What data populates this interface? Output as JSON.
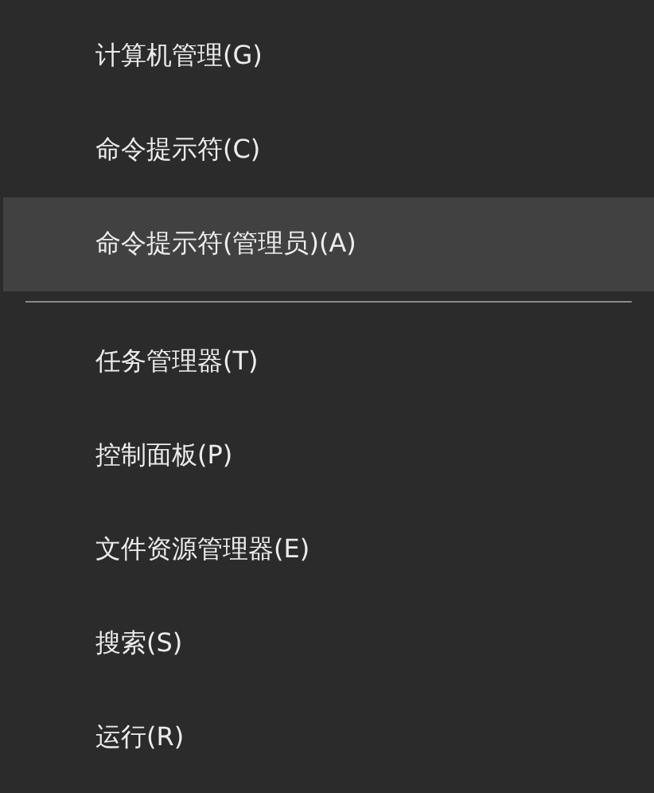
{
  "menu": {
    "items": [
      {
        "kind": "item",
        "label": "计算机管理(G)",
        "selected": false
      },
      {
        "kind": "item",
        "label": "命令提示符(C)",
        "selected": false
      },
      {
        "kind": "item",
        "label": "命令提示符(管理员)(A)",
        "selected": true
      },
      {
        "kind": "separator"
      },
      {
        "kind": "item",
        "label": "任务管理器(T)",
        "selected": false
      },
      {
        "kind": "item",
        "label": "控制面板(P)",
        "selected": false
      },
      {
        "kind": "item",
        "label": "文件资源管理器(E)",
        "selected": false
      },
      {
        "kind": "item",
        "label": "搜索(S)",
        "selected": false
      },
      {
        "kind": "item",
        "label": "运行(R)",
        "selected": false
      }
    ]
  }
}
